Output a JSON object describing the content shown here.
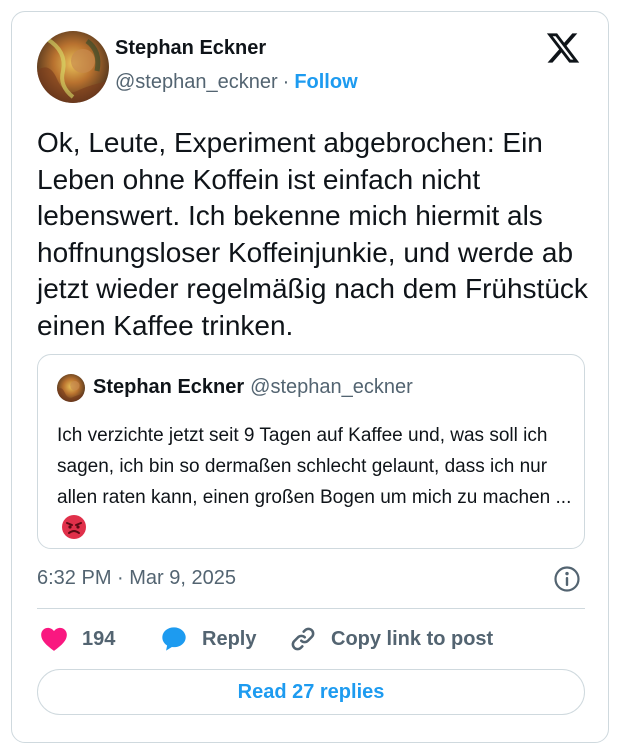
{
  "tweet": {
    "author_name": "Stephan Eckner",
    "author_handle": "@stephan_eckner",
    "separator": "·",
    "follow_label": "Follow",
    "text": "Ok, Leute, Experiment abgebrochen: Ein Leben ohne Koffein ist einfach nicht lebenswert. Ich bekenne mich hiermit als hoffnungsloser Koffeinjunkie, und werde ab jetzt wieder regelmäßig nach dem Frühstück einen Kaffee trinken.",
    "timestamp": "6:32 PM · Mar 9, 2025"
  },
  "quoted_tweet": {
    "author_name": "Stephan Eckner",
    "author_handle": "@stephan_eckner",
    "text": "Ich verzichte jetzt seit 9 Tagen auf Kaffee und, was soll ich sagen, ich bin so dermaßen schlecht gelaunt, dass ich nur allen raten kann, einen großen Bogen um mich zu machen ...",
    "emoji": "angry-face"
  },
  "actions": {
    "like_count": "194",
    "reply_label": "Reply",
    "copy_label": "Copy link to post"
  },
  "footer": {
    "read_replies_label": "Read 27 replies"
  },
  "icons": {
    "brand": "x-logo-icon",
    "info": "info-icon",
    "like": "heart-icon",
    "reply": "speech-bubble-icon",
    "copy": "link-icon"
  },
  "colors": {
    "accent": "#1d9bf0",
    "like": "#f91880",
    "text": "#0f1419",
    "secondary": "#536471",
    "border": "#cfd9de"
  }
}
